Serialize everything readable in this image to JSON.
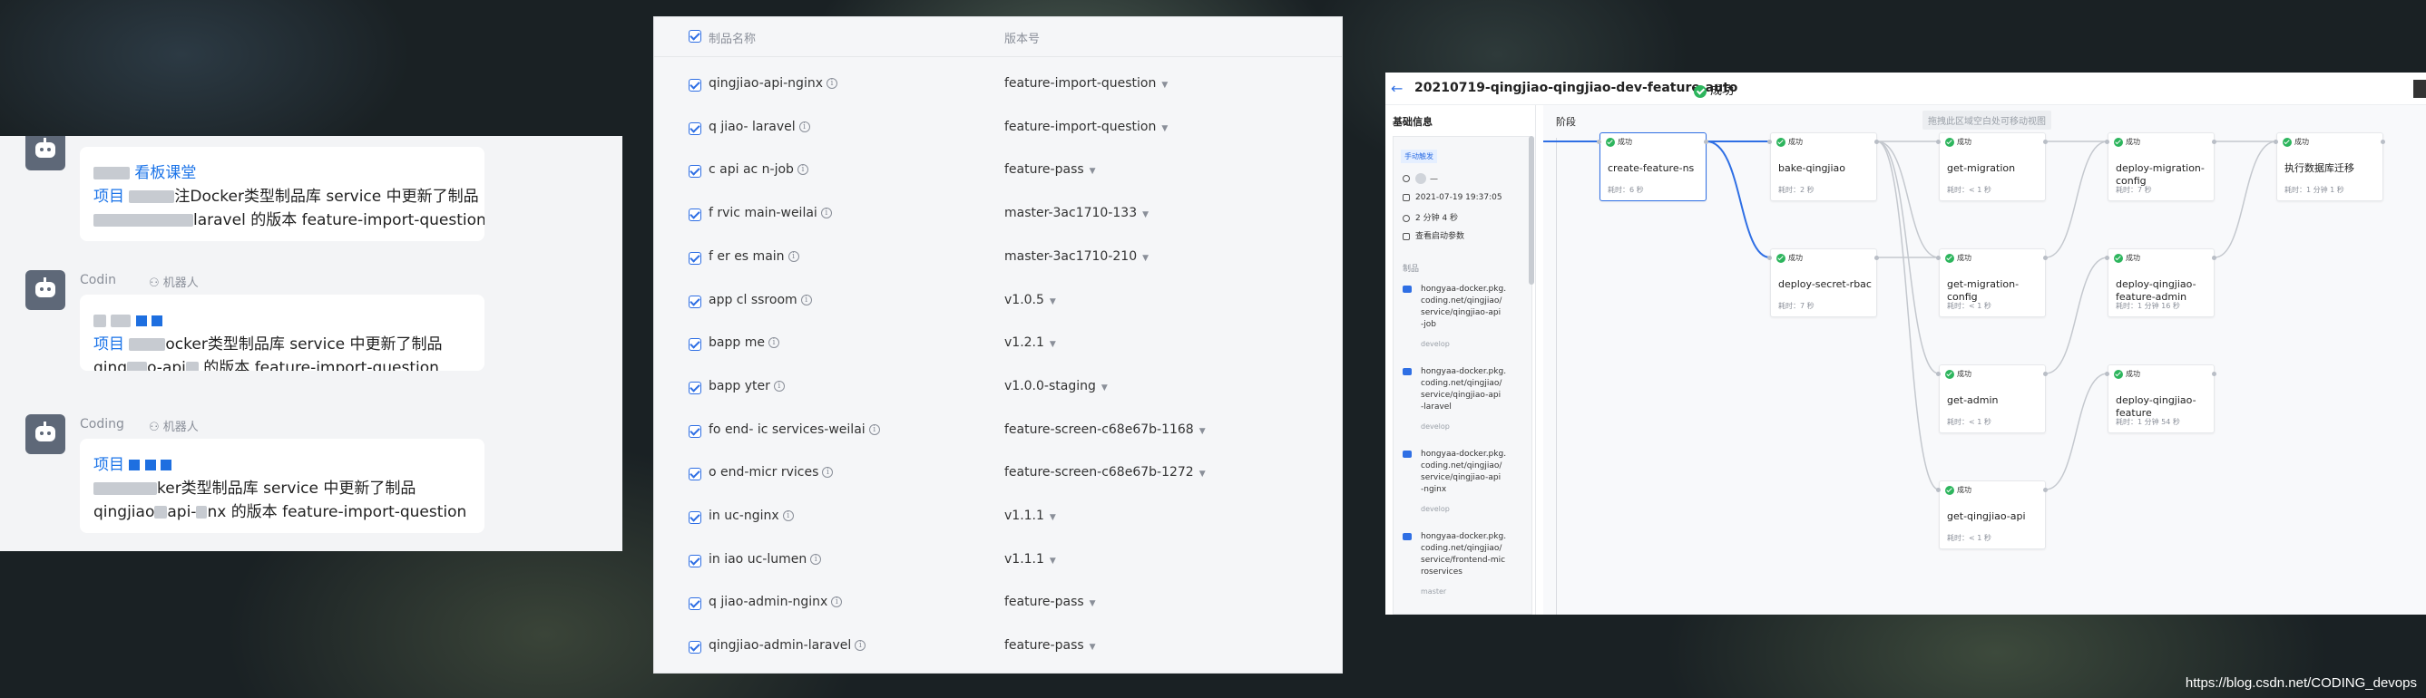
{
  "chat": {
    "messages": [
      {
        "sender": "",
        "tag": "",
        "line1_lead": "",
        "line1_link": "看板课堂",
        "line2_prefix": "项目",
        "line2_rest": "注Docker类型制品库 service 中更新了制品",
        "line3_rest": "laravel 的版本 feature-import-question"
      },
      {
        "sender": "Codin",
        "tag": "机器人",
        "line2_prefix": "项目",
        "line2_rest": "ocker类型制品库 service 中更新了制品",
        "line3_a": "qing",
        "line3_b": "o-api",
        "line3_rest": "的版本 feature-import-question"
      },
      {
        "sender": "Coding",
        "tag": "机器人",
        "line2_prefix": "项目",
        "line2_rest": "ker类型制品库 service 中更新了制品",
        "line3_a": "qingjiao",
        "line3_b": "api-",
        "line3_c": "nx",
        "line3_rest": "的版本 feature-import-question"
      }
    ]
  },
  "artifacts": {
    "header": {
      "name": "制品名称",
      "version": "版本号"
    },
    "rows": [
      {
        "name": "qingjiao-api-nginx",
        "version": "feature-import-question"
      },
      {
        "name": "q  jiao-   laravel",
        "version": "feature-import-question"
      },
      {
        "name": "c   api  ac   n-job",
        "version": "feature-pass"
      },
      {
        "name": "f      rvic   main-weilai",
        "version": "master-3ac1710-133"
      },
      {
        "name": "f      er    es  main",
        "version": "master-3ac1710-210"
      },
      {
        "name": "      app  cl ssroom",
        "version": "v1.0.5"
      },
      {
        "name": "       bapp    me",
        "version": "v1.2.1"
      },
      {
        "name": "       bapp   yter",
        "version": "v1.0.0-staging"
      },
      {
        "name": "fo  end-  ic   services-weilai",
        "version": "feature-screen-c68e67b-1168"
      },
      {
        "name": "  o  end-micr  rvices",
        "version": "feature-screen-c68e67b-1272"
      },
      {
        "name": "in     uc-nginx",
        "version": "v1.1.1"
      },
      {
        "name": "in    iao  uc-lumen",
        "version": "v1.1.1"
      },
      {
        "name": "q   jiao-admin-nginx",
        "version": "feature-pass"
      },
      {
        "name": "qingjiao-admin-laravel",
        "version": "feature-pass"
      }
    ]
  },
  "pipeline": {
    "title": "20210719-qingjiao-qingjiao-dev-feature-auto",
    "status": "成功",
    "sidebar": {
      "title": "基础信息",
      "trigger": "手动触发",
      "user": "—",
      "datetime": "2021-07-19 19:37:05",
      "duration": "2 分钟 4 秒",
      "params": "查看启动参数",
      "products_label": "制品",
      "products": [
        {
          "path": "hongyaa-docker.pkg.\ncoding.net/qingjiao/\nservice/qingjiao-api\n-job",
          "branch": "develop"
        },
        {
          "path": "hongyaa-docker.pkg.\ncoding.net/qingjiao/\nservice/qingjiao-api\n-laravel",
          "branch": "develop"
        },
        {
          "path": "hongyaa-docker.pkg.\ncoding.net/qingjiao/\nservice/qingjiao-api\n-nginx",
          "branch": "develop"
        },
        {
          "path": "hongyaa-docker.pkg.\ncoding.net/qingjiao/\nservice/frontend-mic\nroservices",
          "branch": "master"
        }
      ]
    },
    "canvas": {
      "stage_label": "阶段",
      "hint": "拖拽此区域空白处可移动视图",
      "nodes": [
        {
          "status": "成功",
          "name": "create-feature-ns",
          "time": "耗时：6 秒"
        },
        {
          "status": "成功",
          "name": "bake-qingjiao",
          "time": "耗时：2 秒"
        },
        {
          "status": "成功",
          "name": "deploy-secret-rbac",
          "time": "耗时：7 秒"
        },
        {
          "status": "成功",
          "name": "get-migration",
          "time": "耗时：< 1 秒"
        },
        {
          "status": "成功",
          "name": "get-migration-config",
          "time": "耗时：< 1 秒"
        },
        {
          "status": "成功",
          "name": "get-admin",
          "time": "耗时：< 1 秒"
        },
        {
          "status": "成功",
          "name": "get-qingjiao-api",
          "time": "耗时：< 1 秒"
        },
        {
          "status": "成功",
          "name": "deploy-migration-config",
          "time": "耗时：7 秒"
        },
        {
          "status": "成功",
          "name": "deploy-qingjiao-feature-admin",
          "time": "耗时：1 分钟 16 秒"
        },
        {
          "status": "成功",
          "name": "deploy-qingjiao-feature",
          "time": "耗时：1 分钟 54 秒"
        },
        {
          "status": "成功",
          "name": "执行数据库迁移",
          "time": "耗时：1 分钟 1 秒"
        }
      ]
    }
  },
  "watermark": "https://blog.csdn.net/CODING_devops"
}
